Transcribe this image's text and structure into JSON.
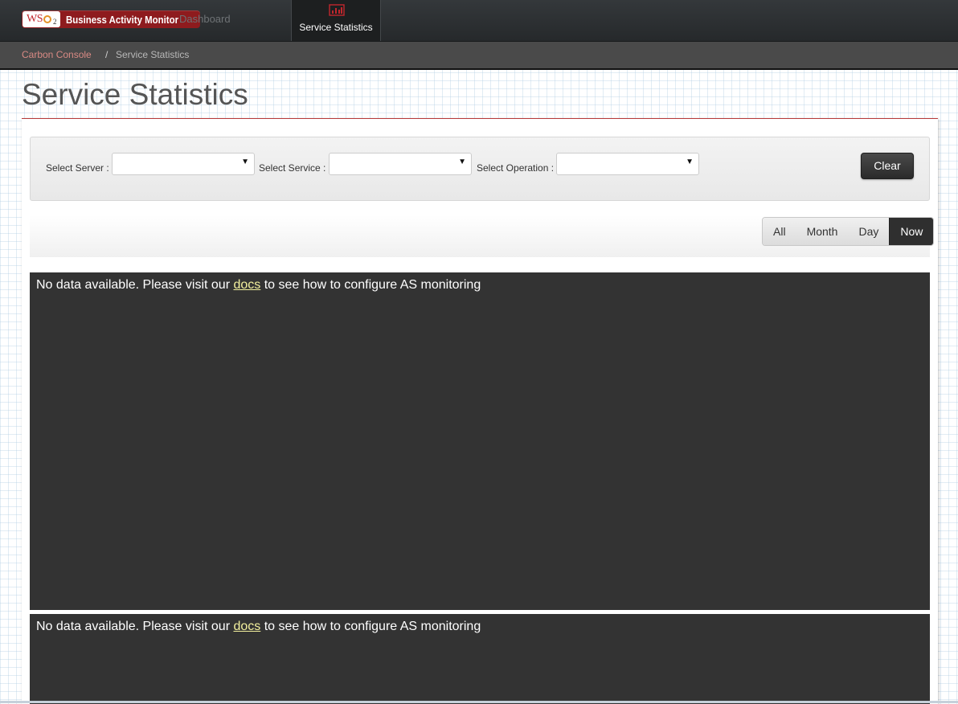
{
  "navbar": {
    "brand_logo": "WSO2",
    "brand_name": "Business Activity Monitor",
    "dashboard_link": "Dashboard",
    "active_tab": "Service Statistics",
    "active_color": "#c2272d"
  },
  "breadcrumb": {
    "items": [
      "Carbon Console",
      "Service Statistics"
    ],
    "separator": "/"
  },
  "page": {
    "title": "Service Statistics"
  },
  "filters": {
    "server_label": "Select Server :",
    "server_value": "",
    "service_label": "Select Service :",
    "service_value": "",
    "operation_label": "Select Operation :",
    "operation_value": "",
    "dropdown_arrow": "▼",
    "clear_label": "Clear"
  },
  "range": {
    "options": [
      "All",
      "Month",
      "Day",
      "Now"
    ],
    "selected": "Now"
  },
  "charts": [
    {
      "msg_before": "No data available. Please visit our",
      "link": "docs",
      "msg_after": "to see how to configure AS monitoring"
    },
    {
      "msg_before": "No data available. Please visit our",
      "link": "docs",
      "msg_after": "to see how to configure AS monitoring"
    }
  ]
}
